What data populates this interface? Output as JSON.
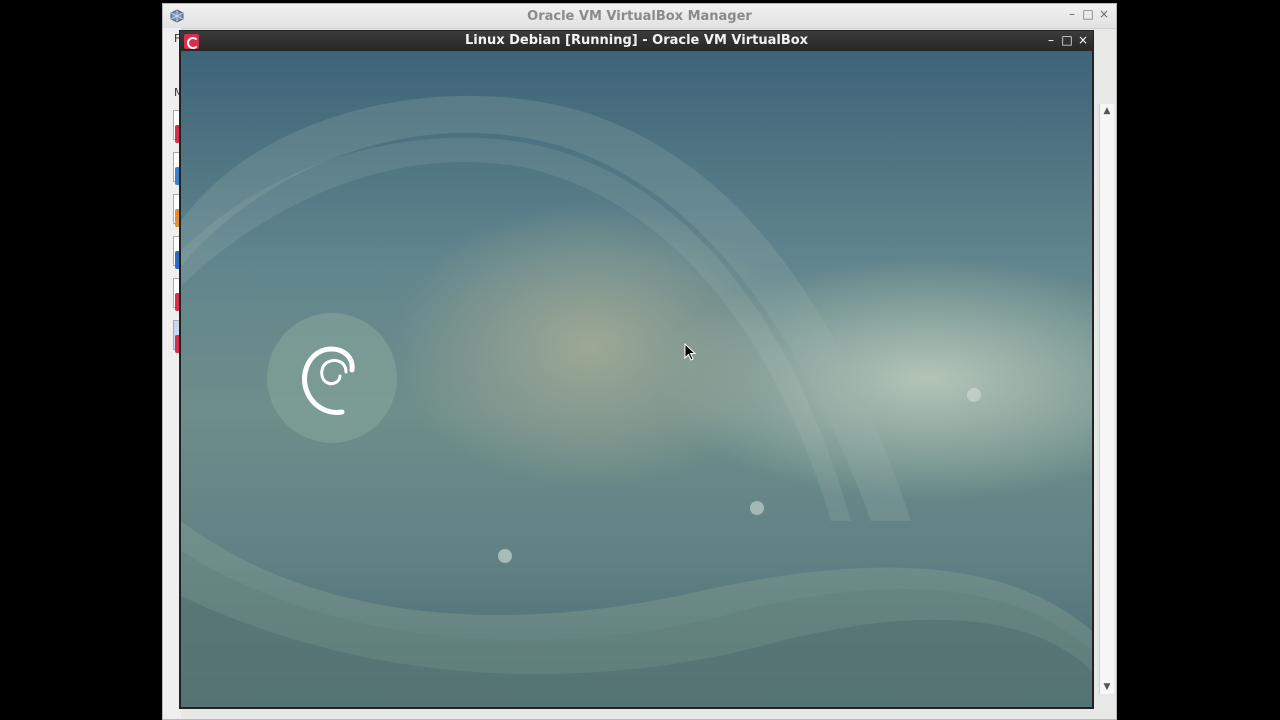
{
  "manager_window": {
    "title": "Oracle VM VirtualBox Manager",
    "icon": "virtualbox-icon",
    "controls": {
      "minimize": "–",
      "maximize": "□",
      "close": "×"
    },
    "side_label_1": "F",
    "side_label_2": "M"
  },
  "vm_window": {
    "title": "Linux Debian [Running] - Oracle VM VirtualBox",
    "icon": "debian-vm-icon",
    "controls": {
      "minimize": "–",
      "maximize": "□",
      "close": "×"
    }
  },
  "guest_screen": {
    "desktop": "debian-wallpaper",
    "logo": "debian-swirl-icon"
  },
  "colors": {
    "vm_titlebar": "#2f2f2f",
    "debian_red": "#d6304d",
    "wallpaper_teal": "#4e737e"
  }
}
